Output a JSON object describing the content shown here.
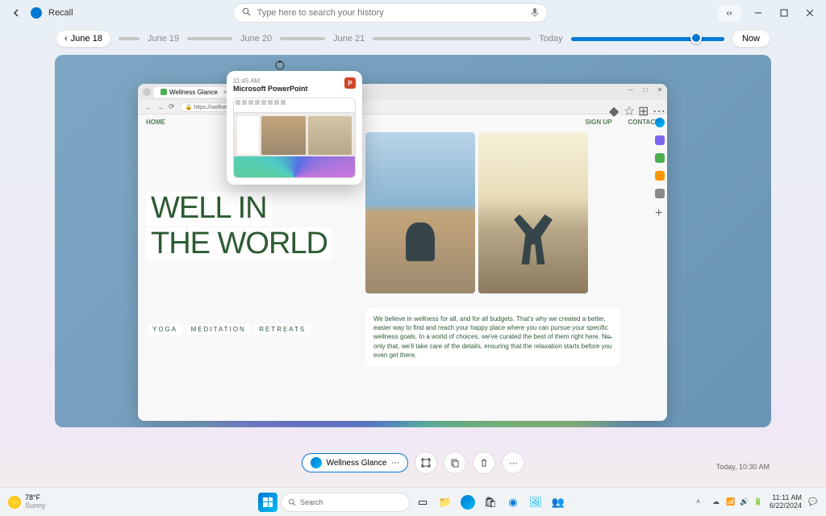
{
  "app": {
    "title": "Recall"
  },
  "search": {
    "placeholder": "Type here to search your history"
  },
  "timeline": {
    "dates": [
      "June 18",
      "June 19",
      "June 20",
      "June 21"
    ],
    "today_label": "Today",
    "now_label": "Now"
  },
  "preview": {
    "time": "11:45 AM",
    "app_name": "Microsoft PowerPoint",
    "app_badge": "P"
  },
  "browser": {
    "tab_title": "Wellness Glance",
    "url": "https://wellnessglance.com",
    "nav_home": "HOME",
    "nav_signup": "SIGN UP",
    "nav_contact": "CONTACT"
  },
  "page": {
    "headline_1": "WELL IN",
    "headline_2": "THE WORLD",
    "keywords": [
      "YOGA",
      "MEDITATION",
      "RETREATS"
    ],
    "body": "We believe in wellness for all, and for all budgets. That's why we created a better, easier way to find and reach your happy place where you can pursue your specific wellness goals. In a world of choices, we've curated the best of them right here. No only that, we'll take care of the details, ensuring that the relaxation starts before you even get there."
  },
  "actions": {
    "app_chip": "Wellness Glance",
    "timestamp": "Today, 10:30 AM"
  },
  "taskbar": {
    "weather_temp": "78°F",
    "weather_cond": "Sunny",
    "search": "Search",
    "time": "11:11 AM",
    "date": "6/22/2024"
  }
}
